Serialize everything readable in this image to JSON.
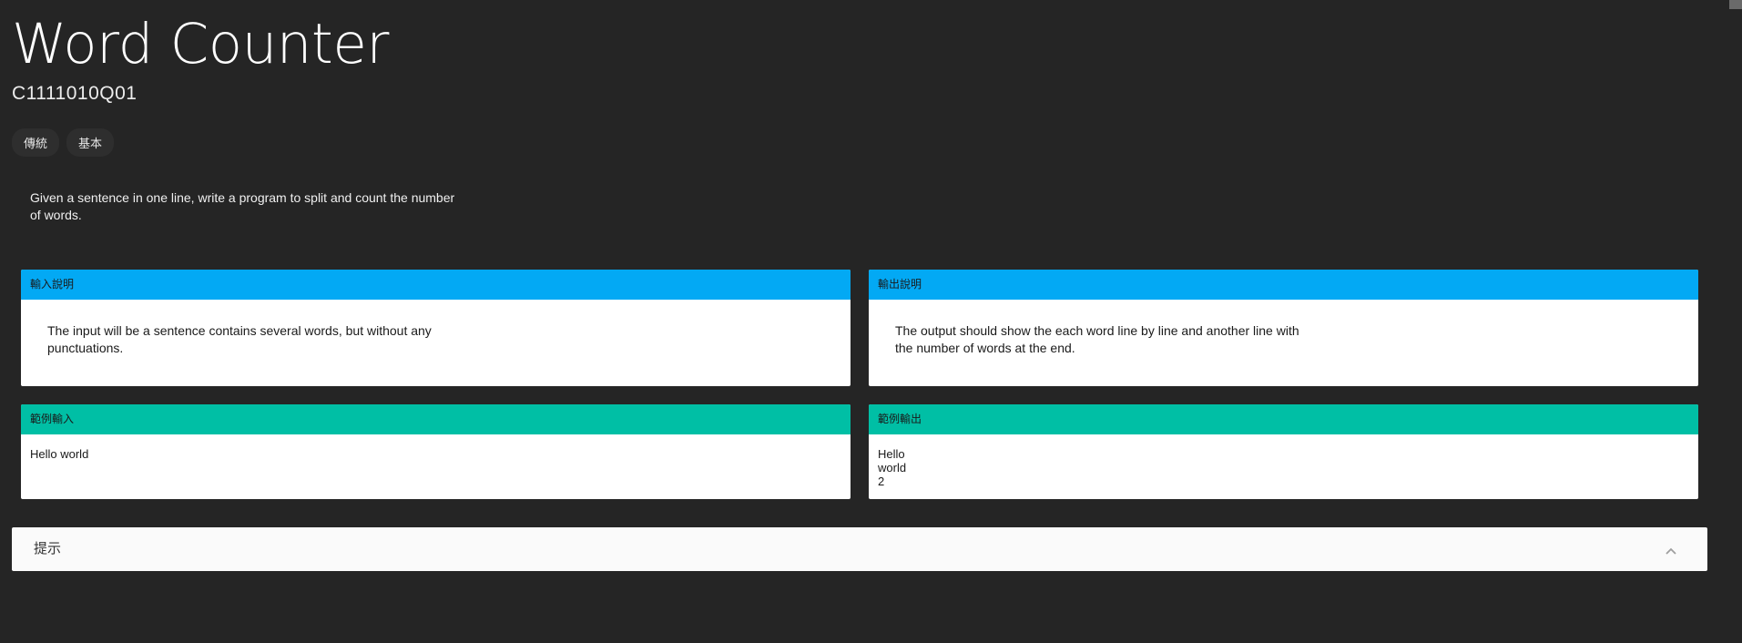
{
  "header": {
    "title": "Word Counter",
    "code": "C1111010Q01"
  },
  "tags": [
    "傳統",
    "基本"
  ],
  "description": "Given a sentence in one line, write a program to split and count the number of words.",
  "panels": {
    "input_explain": {
      "label": "輸入說明",
      "text": "The input will be a sentence contains several words, but without any punctuations."
    },
    "output_explain": {
      "label": "輸出說明",
      "text": "The output should show the each word line by line and another line with the number of words at the end."
    },
    "sample_input": {
      "label": "範例輸入",
      "text": "Hello world"
    },
    "sample_output": {
      "label": "範例輸出",
      "text": "Hello\nworld\n2"
    }
  },
  "hint": {
    "label": "提示",
    "icon": "chevron-up-icon"
  },
  "colors": {
    "background": "#252525",
    "explain_header": "#03a9f4",
    "sample_header": "#00bfa5"
  }
}
